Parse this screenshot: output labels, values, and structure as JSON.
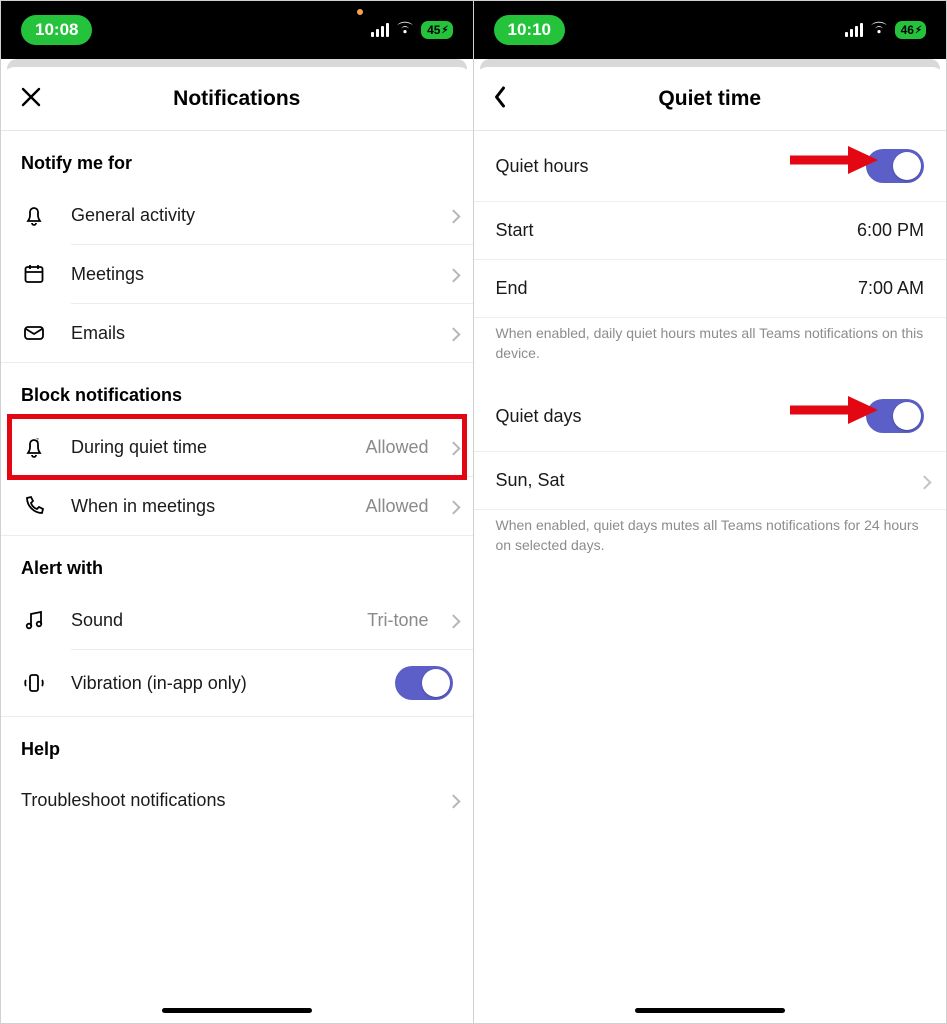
{
  "left": {
    "status": {
      "time": "10:08",
      "battery": "45"
    },
    "title": "Notifications",
    "sections": {
      "notify_header": "Notify me for",
      "notify_items": [
        {
          "label": "General activity"
        },
        {
          "label": "Meetings"
        },
        {
          "label": "Emails"
        }
      ],
      "block_header": "Block notifications",
      "block_items": [
        {
          "label": "During quiet time",
          "value": "Allowed"
        },
        {
          "label": "When in meetings",
          "value": "Allowed"
        }
      ],
      "alert_header": "Alert with",
      "sound": {
        "label": "Sound",
        "value": "Tri-tone"
      },
      "vibration": {
        "label": "Vibration (in-app only)"
      },
      "help_header": "Help",
      "troubleshoot": {
        "label": "Troubleshoot notifications"
      }
    }
  },
  "right": {
    "status": {
      "time": "10:10",
      "battery": "46"
    },
    "title": "Quiet time",
    "quiet_hours": {
      "label": "Quiet hours"
    },
    "start": {
      "label": "Start",
      "value": "6:00 PM"
    },
    "end": {
      "label": "End",
      "value": "7:00 AM"
    },
    "hours_note": "When enabled, daily quiet hours mutes all Teams notifications on this device.",
    "quiet_days": {
      "label": "Quiet days"
    },
    "days": {
      "label": "Sun, Sat"
    },
    "days_note": "When enabled, quiet days mutes all Teams notifications for 24 hours on selected days."
  }
}
